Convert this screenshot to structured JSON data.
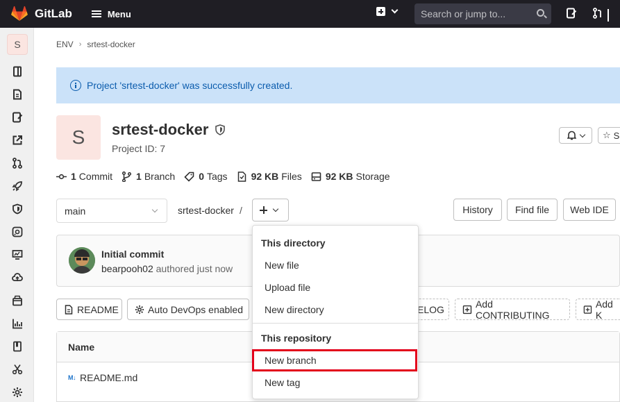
{
  "topbar": {
    "app_name": "GitLab",
    "menu_label": "Menu",
    "search_placeholder": "Search or jump to..."
  },
  "sidebar": {
    "project_initial": "S",
    "icons": [
      "project-overview-icon",
      "repository-icon",
      "issues-icon",
      "external-link-icon",
      "merge-requests-icon",
      "cicd-rocket-icon",
      "security-shield-icon",
      "deployments-icon",
      "monitor-icon",
      "infrastructure-cloud-icon",
      "packages-icon",
      "analytics-chart-icon",
      "wiki-book-icon",
      "snippets-scissors-icon",
      "settings-gear-icon"
    ]
  },
  "breadcrumb": {
    "group": "ENV",
    "project": "srtest-docker"
  },
  "alert": {
    "message": "Project 'srtest-docker' was successfully created."
  },
  "project": {
    "initial": "S",
    "name": "srtest-docker",
    "id_label": "Project ID: 7",
    "star_label": "S"
  },
  "stats": [
    {
      "icon": "commit-icon",
      "value": "1",
      "label": "Commit"
    },
    {
      "icon": "branch-icon",
      "value": "1",
      "label": "Branch"
    },
    {
      "icon": "tag-icon",
      "value": "0",
      "label": "Tags"
    },
    {
      "icon": "file-icon",
      "value": "92 KB",
      "label": "Files"
    },
    {
      "icon": "storage-icon",
      "value": "92 KB",
      "label": "Storage"
    }
  ],
  "repo_toolbar": {
    "branch": "main",
    "path": "srtest-docker",
    "path_sep": "/",
    "history": "History",
    "find_file": "Find file",
    "web_ide": "Web IDE"
  },
  "commit": {
    "title": "Initial commit",
    "author": "bearpooh02",
    "meta": "authored just now"
  },
  "quick_actions": {
    "readme": "README",
    "auto_devops": "Auto DevOps enabled",
    "changelog": "ELOG",
    "contributing": "Add CONTRIBUTING",
    "add_k": "Add K"
  },
  "file_table": {
    "header": "Name",
    "rows": [
      "README.md"
    ]
  },
  "dropdown": {
    "section1": "This directory",
    "items1": [
      "New file",
      "Upload file",
      "New directory"
    ],
    "section2": "This repository",
    "items2": [
      "New branch",
      "New tag"
    ]
  }
}
